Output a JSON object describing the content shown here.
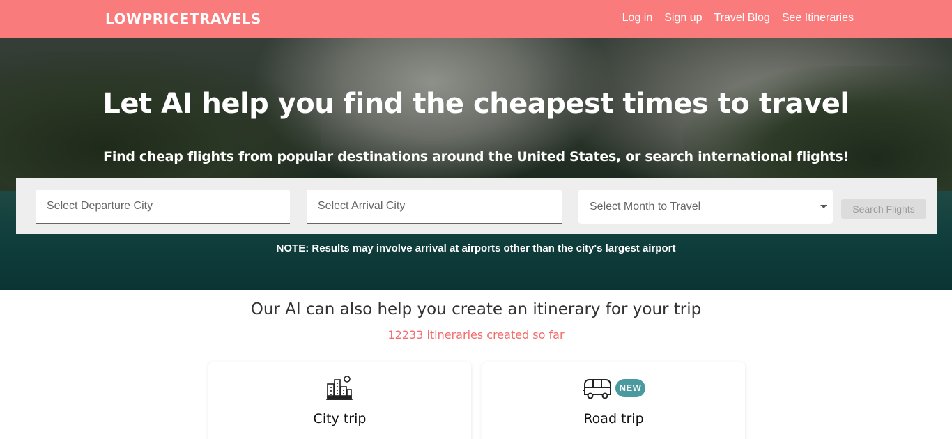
{
  "header": {
    "brand": "LOWPRICETRAVELS",
    "nav": [
      "Log in",
      "Sign up",
      "Travel Blog",
      "See Itineraries"
    ]
  },
  "hero": {
    "title": "Let AI help you find the cheapest times to travel",
    "subtitle": "Find cheap flights from popular destinations around the United States, or search international flights!",
    "departure_placeholder": "Select Departure City",
    "arrival_placeholder": "Select Arrival City",
    "month_placeholder": "Select Month to Travel",
    "search_button": "Search Flights",
    "note": "NOTE: Results may involve arrival at airports other than the city's largest airport"
  },
  "itinerary": {
    "title": "Our AI can also help you create an itinerary for your trip",
    "counter": "12233 itineraries created so far",
    "cards": [
      {
        "label": "City trip",
        "icon": "city-buildings-icon"
      },
      {
        "label": "Road trip",
        "icon": "van-icon",
        "badge": "NEW"
      }
    ]
  },
  "colors": {
    "header_bg": "#fa7b7b",
    "counter": "#f36b6b",
    "badge_bg": "#4a9aa0"
  }
}
